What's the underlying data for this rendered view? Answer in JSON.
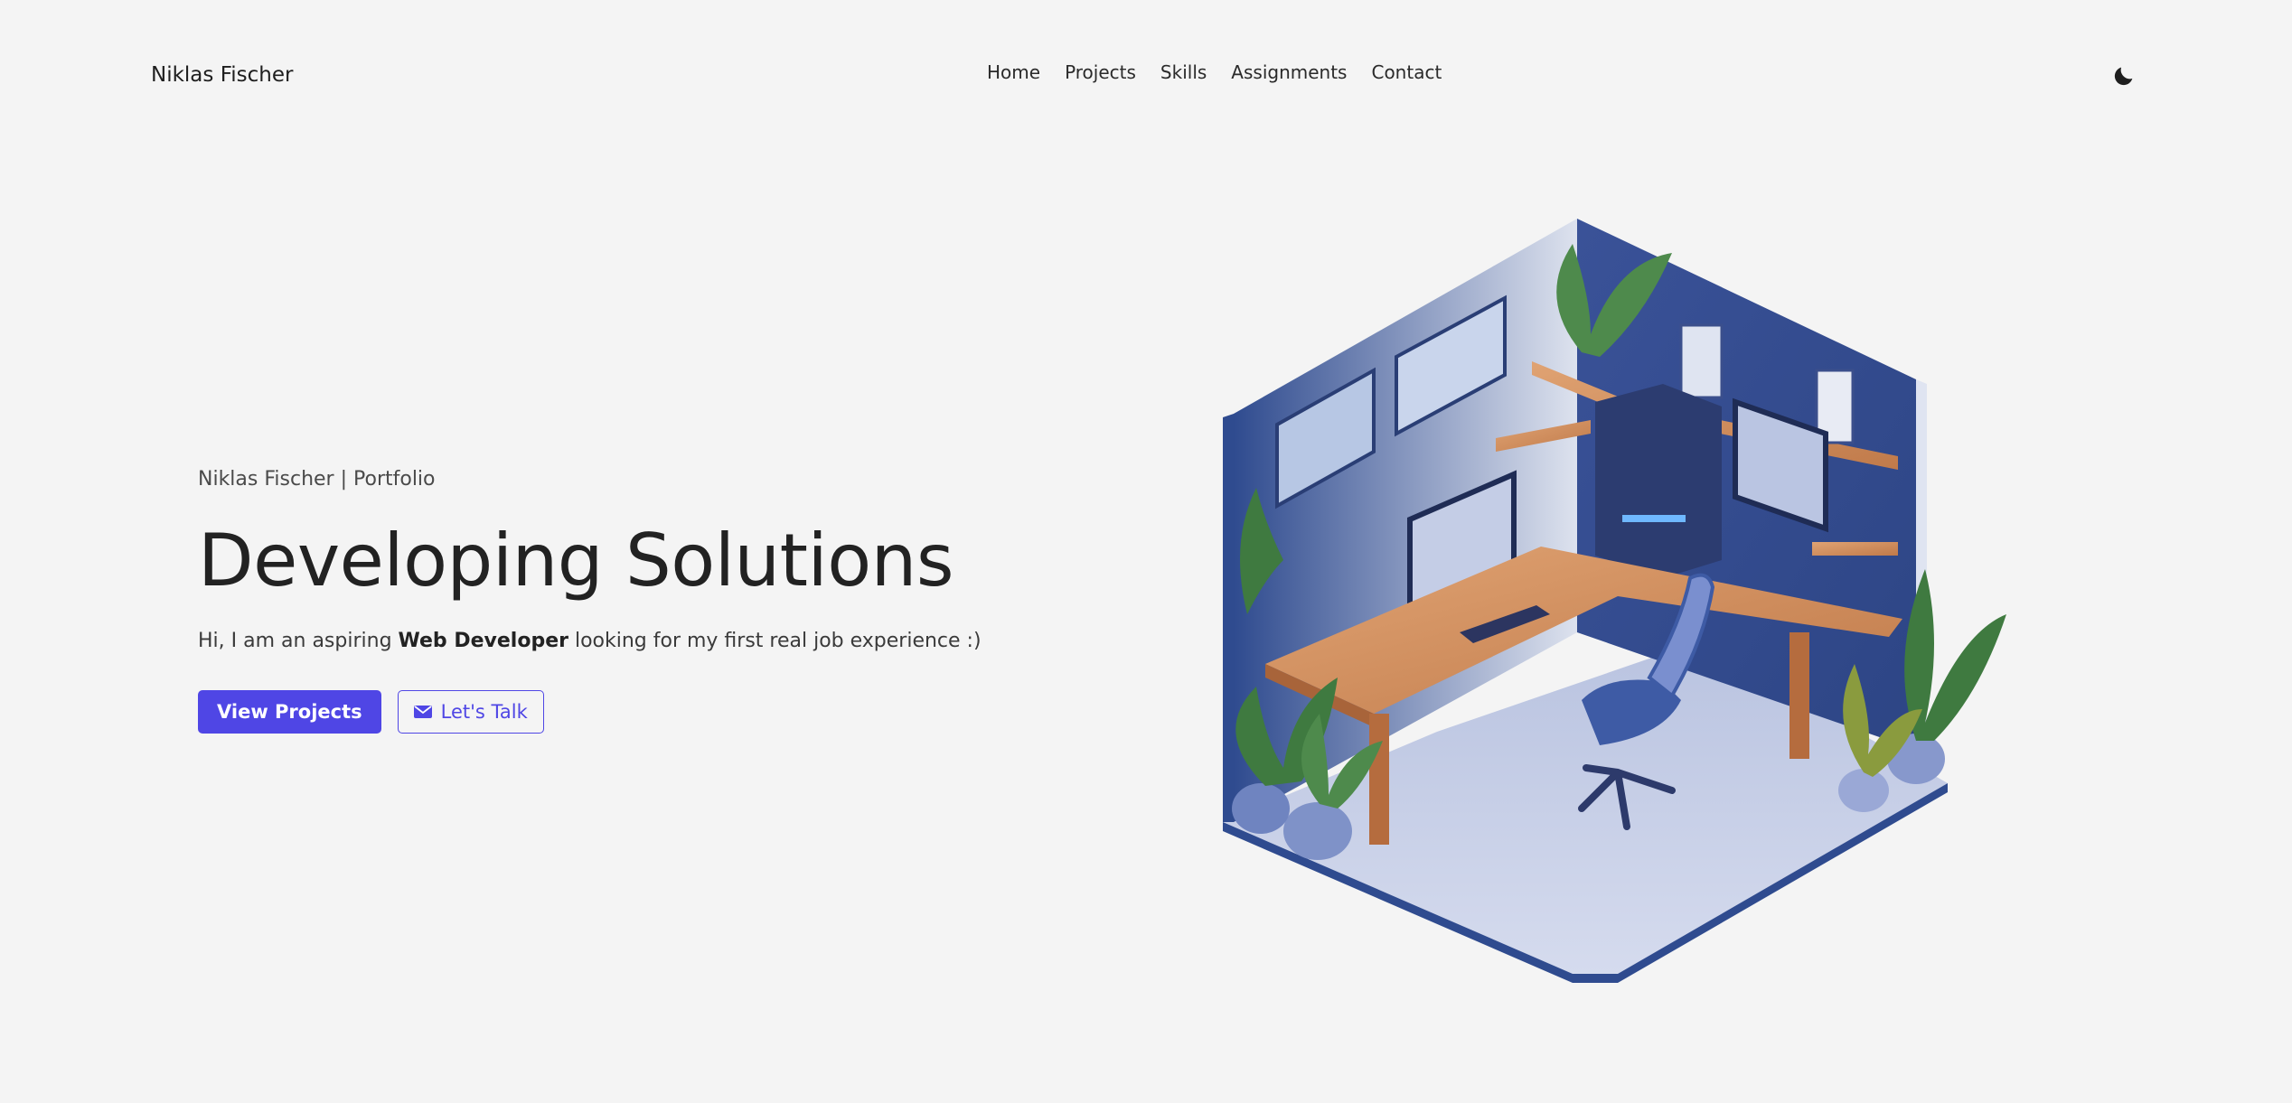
{
  "nav": {
    "brand": "Niklas Fischer",
    "links": [
      "Home",
      "Projects",
      "Skills",
      "Assignments",
      "Contact"
    ],
    "theme_icon": "moon-icon"
  },
  "hero": {
    "eyebrow": "Niklas Fischer | Portfolio",
    "headline": "Developing Solutions",
    "tagline_pre": "Hi, I am an aspiring ",
    "tagline_bold": "Web Developer",
    "tagline_post": " looking for my first real job experience :)",
    "primary_button": "View Projects",
    "secondary_button": "Let's Talk",
    "secondary_icon": "envelope-icon"
  },
  "illustration": {
    "subject": "isometric-workspace-room",
    "icon": "workspace-illustration"
  },
  "colors": {
    "background": "#f4f4f4",
    "accent": "#4f46e5",
    "text": "#222222"
  }
}
